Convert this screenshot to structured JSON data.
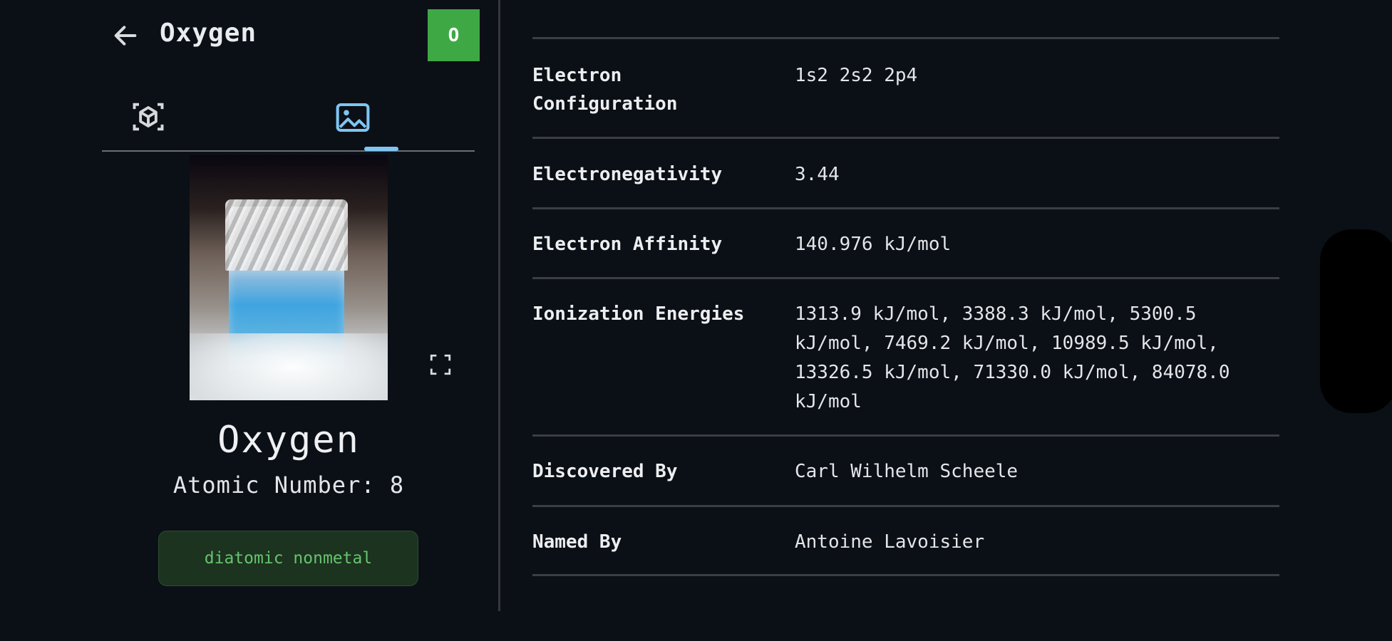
{
  "header": {
    "back_icon": "arrow-left-icon",
    "title": "Oxygen",
    "symbol": "O",
    "symbol_color": "#3ea845"
  },
  "tabs": [
    {
      "icon": "atom-3d-icon",
      "selected": false
    },
    {
      "icon": "image-icon",
      "selected": true
    }
  ],
  "element": {
    "name": "Oxygen",
    "atomic_number_text": "Atomic Number: 8",
    "category": "diatomic nonmetal",
    "category_color": "#67c36e",
    "expand_icon": "fullscreen-icon"
  },
  "properties": [
    {
      "label": "Electron Configuration",
      "value": "1s2 2s2 2p4"
    },
    {
      "label": "Electronegativity",
      "value": "3.44"
    },
    {
      "label": "Electron Affinity",
      "value": "140.976 kJ/mol"
    },
    {
      "label": "Ionization Energies",
      "value": "1313.9 kJ/mol, 3388.3 kJ/mol, 5300.5 kJ/mol, 7469.2 kJ/mol, 10989.5 kJ/mol, 13326.5 kJ/mol, 71330.0 kJ/mol, 84078.0 kJ/mol"
    },
    {
      "label": "Discovered By",
      "value": "Carl Wilhelm Scheele"
    },
    {
      "label": "Named By",
      "value": "Antoine Lavoisier"
    }
  ]
}
